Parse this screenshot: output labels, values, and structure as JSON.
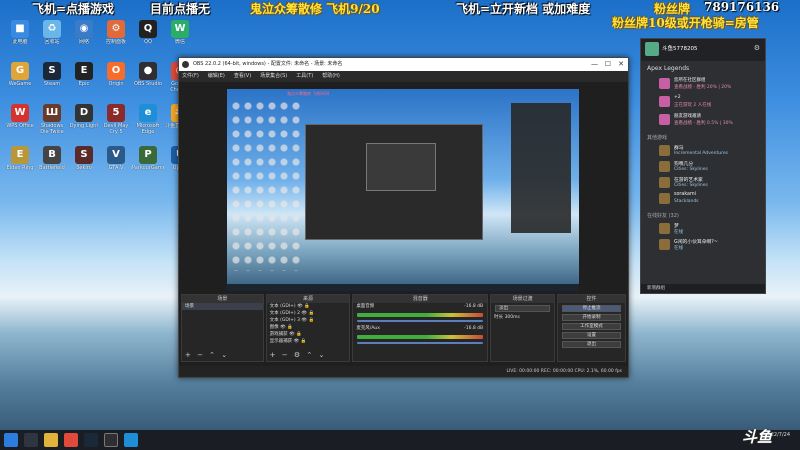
{
  "overlay": {
    "line1": "飞机=点播游戏",
    "line2": "目前点播无",
    "line3": "鬼泣众筹散修 飞机9/20",
    "line4": "飞机=立开新档  或加难度",
    "line5": "粉丝牌",
    "line6": "789176136",
    "line7": "粉丝牌10级或开枪骑=房管"
  },
  "desktop_icons": [
    {
      "label": "此电脑",
      "color": "#3a8be0",
      "glyph": "■"
    },
    {
      "label": "回收站",
      "color": "#6ab6e8",
      "glyph": "♻"
    },
    {
      "label": "网络",
      "color": "#3a7bc8",
      "glyph": "◉"
    },
    {
      "label": "控制面板",
      "color": "#e06a3a",
      "glyph": "⚙"
    },
    {
      "label": "QQ",
      "color": "#222",
      "glyph": "Q"
    },
    {
      "label": "微信",
      "color": "#2aae67",
      "glyph": "W"
    },
    {
      "label": "WeGame",
      "color": "#e0a53a",
      "glyph": "G"
    },
    {
      "label": "Steam",
      "color": "#1b2838",
      "glyph": "S"
    },
    {
      "label": "Epic",
      "color": "#222",
      "glyph": "E"
    },
    {
      "label": "Origin",
      "color": "#f56c2d",
      "glyph": "O"
    },
    {
      "label": "OBS Studio",
      "color": "#302e31",
      "glyph": "●"
    },
    {
      "label": "Google Chrome",
      "color": "#e04a3a",
      "glyph": "◎"
    },
    {
      "label": "WPS Office",
      "color": "#d6332e",
      "glyph": "W"
    },
    {
      "label": "Shadows Die Twice",
      "color": "#6a3a2a",
      "glyph": "Ш"
    },
    {
      "label": "Dying Light",
      "color": "#333",
      "glyph": "D"
    },
    {
      "label": "Devil May Cry 5",
      "color": "#8a2a2a",
      "glyph": "5"
    },
    {
      "label": "Microsoft Edge",
      "color": "#1e8fd6",
      "glyph": "e"
    },
    {
      "label": "斗鱼直播伴侣",
      "color": "#f5a623",
      "glyph": "斗"
    },
    {
      "label": "Elden Ring",
      "color": "#b8963a",
      "glyph": "E"
    },
    {
      "label": "Battlefield",
      "color": "#444",
      "glyph": "B"
    },
    {
      "label": "Sekiro",
      "color": "#5a2a2a",
      "glyph": "S"
    },
    {
      "label": "GTA V",
      "color": "#2a5a8a",
      "glyph": "V"
    },
    {
      "label": "ParkourGame",
      "color": "#3a6a3a",
      "glyph": "P"
    },
    {
      "label": "Uplay",
      "color": "#1e5fa8",
      "glyph": "U"
    }
  ],
  "obs": {
    "title": "OBS 22.0.2 (64-bit, windows) - 配置文件: 未命名 - 场景: 未命名",
    "menu": [
      "文件(F)",
      "编辑(E)",
      "查看(V)",
      "场景集合(S)",
      "工具(T)",
      "帮助(H)"
    ],
    "docks": {
      "scenes": {
        "title": "场景",
        "items": [
          "场景"
        ]
      },
      "sources": {
        "title": "来源",
        "items": [
          "文本 (GDI+)",
          "文本 (GDI+) 2",
          "文本 (GDI+) 3",
          "图像",
          "游戏捕获",
          "显示器捕获"
        ]
      },
      "mixer": {
        "title": "混音器",
        "tracks": [
          {
            "name": "桌面音频",
            "db": "-16.8 dB"
          },
          {
            "name": "麦克风/Aux",
            "db": "-16.8 dB"
          }
        ]
      },
      "transitions": {
        "title": "场景过渡",
        "mode": "淡出",
        "duration_label": "时长",
        "duration": "300ms"
      },
      "controls": {
        "title": "控件",
        "buttons": [
          "停止推流",
          "开始录制",
          "工作室模式",
          "设置",
          "退出"
        ]
      }
    },
    "status": "LIVE: 00:00:00    REC: 00:00:00    CPU: 2.1%, 60.00 fps"
  },
  "chat": {
    "user": "斗鱼5778205",
    "game_section": "Apex Legends",
    "messages": [
      {
        "line1": "您所在社区群组",
        "line2": "查看战绩 - 胜利 20% | 20%"
      },
      {
        "line1": "+2",
        "line2": "正在游玩 2 人在线"
      },
      {
        "line1": "朋友游戏邀请",
        "line2": "查看战绩 - 胜利 0.5% | 30%"
      }
    ],
    "other_section": "其他游戏",
    "friends": [
      {
        "name": "群马",
        "status": "Incremental Adventures"
      },
      {
        "name": "狗嘿几分",
        "status": "Cities: Skylines"
      },
      {
        "name": "在游的艺术家",
        "status": "Cities: Skylines"
      },
      {
        "name": "sorakami",
        "status": "Stacklands"
      }
    ],
    "online_section": "在线好友 (32)",
    "online_friends": [
      {
        "name": "梦",
        "status": "在线"
      },
      {
        "name": "G闲的小伙耳朵啊?~",
        "status": "在线"
      }
    ],
    "footer": "新增群组"
  },
  "taskbar": {
    "date": "2022/7/24",
    "apps": [
      "start",
      "search",
      "explorer",
      "chrome",
      "steam",
      "obs",
      "qq"
    ]
  },
  "watermark": "斗鱼"
}
